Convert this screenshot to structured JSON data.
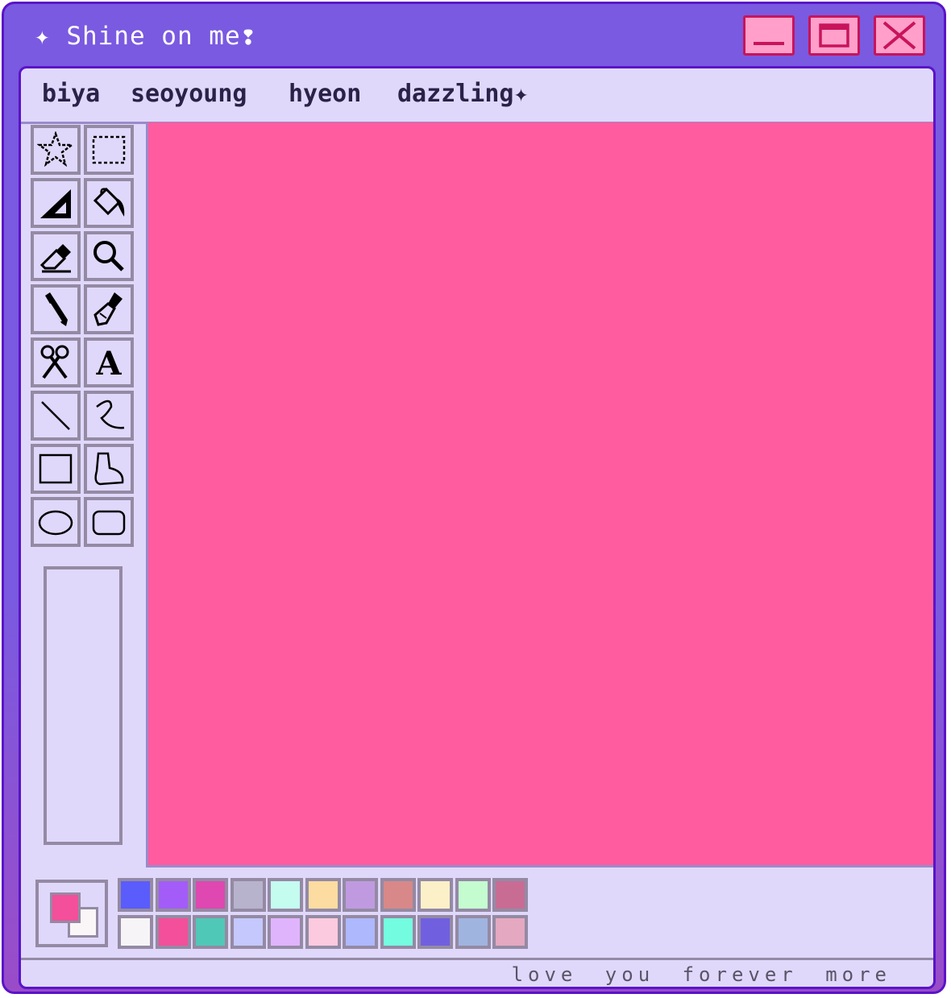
{
  "window": {
    "title": "✦ Shine on me❢"
  },
  "menu": {
    "items": [
      "biya",
      "seoyoung",
      "hyeon",
      "dazzling✦"
    ]
  },
  "tools": [
    {
      "name": "free-select-star-icon",
      "label": "star select"
    },
    {
      "name": "rect-select-icon",
      "label": "rectangle select"
    },
    {
      "name": "triangle-ruler-icon",
      "label": "triangle"
    },
    {
      "name": "paint-bucket-icon",
      "label": "fill"
    },
    {
      "name": "eraser-icon",
      "label": "eraser"
    },
    {
      "name": "magnifier-icon",
      "label": "zoom"
    },
    {
      "name": "pencil-icon",
      "label": "pencil"
    },
    {
      "name": "brush-icon",
      "label": "brush"
    },
    {
      "name": "scissors-icon",
      "label": "scissors"
    },
    {
      "name": "text-icon",
      "label": "A"
    },
    {
      "name": "line-icon",
      "label": "line"
    },
    {
      "name": "curve-icon",
      "label": "curve"
    },
    {
      "name": "rectangle-icon",
      "label": "rectangle"
    },
    {
      "name": "polygon-icon",
      "label": "polygon"
    },
    {
      "name": "ellipse-icon",
      "label": "ellipse"
    },
    {
      "name": "rounded-rect-icon",
      "label": "rounded rectangle"
    }
  ],
  "canvas": {
    "color": "#ff5ca0"
  },
  "current_colors": {
    "foreground": "#f34f9a",
    "background": "#faf6f8"
  },
  "palette": {
    "row1": [
      "#5b5cfc",
      "#a35cf8",
      "#de48b0",
      "#b8b3cc",
      "#c5fcf0",
      "#fcdca0",
      "#c09ae0",
      "#d88888",
      "#fcf0c8",
      "#c4fcd0",
      "#c86c94"
    ],
    "row2": [
      "#f6f4f6",
      "#f34f9a",
      "#50c8b8",
      "#c4c8fc",
      "#e0b4fc",
      "#fccade",
      "#aeb8fc",
      "#74fce0",
      "#7060e0",
      "#a0b4e0",
      "#e4a8c0"
    ]
  },
  "status": {
    "text": "love you forever more"
  }
}
